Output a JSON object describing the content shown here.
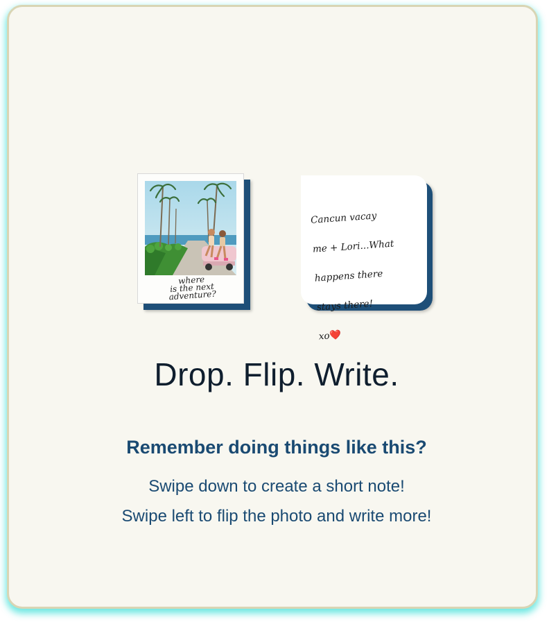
{
  "polaroid": {
    "caption_lines": [
      "where",
      "is the next",
      "adventure?"
    ]
  },
  "note": {
    "text_lines": [
      "Cancun vacay",
      "me + Lori...What",
      "happens there",
      "stays there!",
      "xo"
    ],
    "heart": "❤️"
  },
  "headline": "Drop. Flip. Write.",
  "subhead": "Remember doing things like this?",
  "instructions": [
    "Swipe down to create a short note!",
    "Swipe left to flip the photo and write more!"
  ],
  "colors": {
    "card_background": "#f8f7f0",
    "card_border": "#d9d5b4",
    "glow": "#40e0d8",
    "accent_navy": "#1e4f78",
    "text_blue": "#1a4a72",
    "headline_text": "#0f1e2e"
  }
}
